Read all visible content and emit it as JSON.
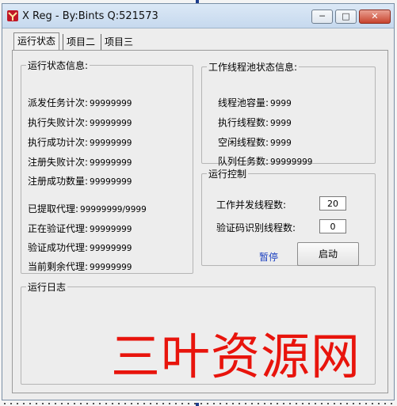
{
  "window": {
    "title": "X Reg - By:Bints Q:521573",
    "colors": {
      "watermark": "#e8140c",
      "link": "#1a3fbf"
    }
  },
  "tabs": [
    {
      "label": "运行状态"
    },
    {
      "label": "项目二"
    },
    {
      "label": "项目三"
    }
  ],
  "status_group": {
    "title": "运行状态信息:",
    "rows": [
      {
        "label": "派发任务计次:",
        "value": "99999999"
      },
      {
        "label": "执行失败计次:",
        "value": "99999999"
      },
      {
        "label": "执行成功计次:",
        "value": "99999999"
      },
      {
        "label": "注册失败计次:",
        "value": "99999999"
      },
      {
        "label": "注册成功数量:",
        "value": "99999999"
      }
    ],
    "proxy_rows": [
      {
        "label": "已提取代理:",
        "value": "99999999/9999"
      },
      {
        "label": "正在验证代理:",
        "value": "99999999"
      },
      {
        "label": "验证成功代理:",
        "value": "99999999"
      },
      {
        "label": "当前剩余代理:",
        "value": "99999999"
      }
    ]
  },
  "pool_group": {
    "title": "工作线程池状态信息:",
    "rows": [
      {
        "label": "线程池容量:",
        "value": "9999"
      },
      {
        "label": "执行线程数:",
        "value": "9999"
      },
      {
        "label": "空闲线程数:",
        "value": "9999"
      },
      {
        "label": "队列任务数:",
        "value": "99999999"
      }
    ]
  },
  "control_group": {
    "title": "运行控制",
    "concurrency_label": "工作并发线程数:",
    "concurrency_value": "20",
    "captcha_label": "验证码识别线程数:",
    "captcha_value": "0",
    "pause_label": "暂停",
    "start_label": "启动"
  },
  "log_group": {
    "title": "运行日志"
  },
  "watermark": "三叶资源网",
  "icons": [
    "app-icon",
    "minimize-icon",
    "maximize-icon",
    "close-icon"
  ]
}
